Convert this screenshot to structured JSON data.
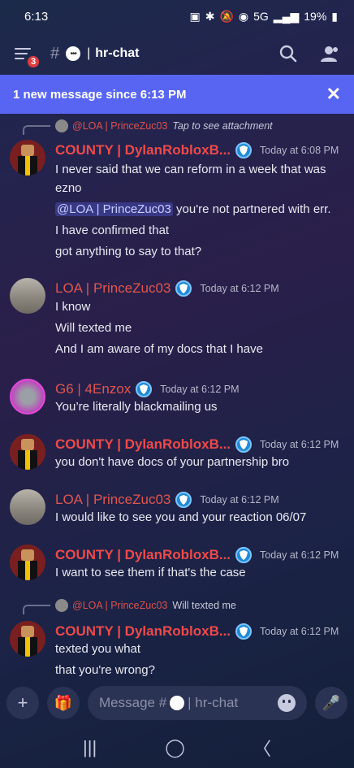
{
  "status_bar": {
    "time": "6:13",
    "signal": "5G",
    "battery": "19%"
  },
  "header": {
    "badge_count": "3",
    "channel_name": "hr-chat",
    "pipe": "|",
    "hash": "#"
  },
  "new_messages_bar": {
    "text": "1 new message since 6:13 PM",
    "close_glyph": "✕"
  },
  "messages": [
    {
      "reply": {
        "name": "@LOA | PrinceZuc03",
        "text": "Tap to see attachment"
      },
      "author": "COUNTY | DylanRobloxB...",
      "time": "Today at 6:08 PM",
      "lines": [
        "I never said that we can reform in a week that was",
        "ezno"
      ],
      "mention_line": {
        "mention": "@LOA | PrinceZuc03",
        "rest": " you're not partnered with err."
      },
      "extra_lines": [
        "I have confirmed that",
        "got anything to say to that?"
      ]
    },
    {
      "author": "LOA | PrinceZuc03",
      "time": "Today at 6:12 PM",
      "lines": [
        "I know",
        "Will texted me",
        "And I am aware of my docs that I have"
      ]
    },
    {
      "author": "G6 | 4Enzox",
      "time": "Today at 6:12 PM",
      "lines": [
        "You’re literally blackmailing us"
      ]
    },
    {
      "author": "COUNTY | DylanRobloxB...",
      "time": "Today at 6:12 PM",
      "lines": [
        "you don't have docs of your partnership bro"
      ]
    },
    {
      "author": "LOA | PrinceZuc03",
      "time": "Today at 6:12 PM",
      "lines": [
        "I would like to see you and your reaction 06/07"
      ]
    },
    {
      "author": "COUNTY | DylanRobloxB...",
      "time": "Today at 6:12 PM",
      "lines": [
        "I want to see them if that's the case"
      ]
    },
    {
      "reply": {
        "name": "@LOA | PrinceZuc03",
        "text": "Will texted me"
      },
      "author": "COUNTY | DylanRobloxB...",
      "time": "Today at 6:12 PM",
      "lines": [
        "texted you what",
        "that you're wrong?"
      ]
    }
  ],
  "composer": {
    "placeholder_prefix": "Message #",
    "placeholder_channel": "| hr-chat",
    "plus_glyph": "+",
    "gift_glyph": "🎁",
    "mic_glyph": "🎤"
  },
  "nav": {
    "recents": "|||",
    "home": "◯",
    "back": "〈"
  },
  "icons": [
    "menu-icon",
    "search-icon",
    "members-icon",
    "close-icon",
    "shield-icon",
    "plus-icon",
    "gift-icon",
    "emoji-icon",
    "mic-icon"
  ]
}
